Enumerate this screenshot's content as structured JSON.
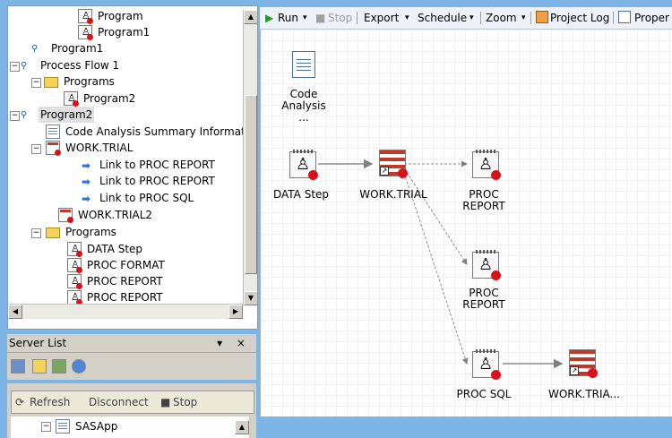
{
  "tree": {
    "items": [
      {
        "label": "Program",
        "icon": "program-icon"
      },
      {
        "label": "Program1",
        "icon": "program-icon"
      },
      {
        "label": "Program1",
        "icon": "process-flow-icon"
      },
      {
        "label": "Process Flow 1",
        "icon": "process-flow-icon"
      },
      {
        "label": "Programs",
        "icon": "folder-icon"
      },
      {
        "label": "Program2",
        "icon": "program-icon"
      },
      {
        "label": "Program2",
        "icon": "process-flow-icon"
      },
      {
        "label": "Code Analysis Summary Information",
        "icon": "document-icon"
      },
      {
        "label": "WORK.TRIAL",
        "icon": "table-icon"
      },
      {
        "label": "Link to PROC REPORT",
        "icon": "link-icon"
      },
      {
        "label": "Link to PROC REPORT",
        "icon": "link-icon"
      },
      {
        "label": "Link to PROC SQL",
        "icon": "link-icon"
      },
      {
        "label": "WORK.TRIAL2",
        "icon": "table-icon"
      },
      {
        "label": "Programs",
        "icon": "folder-icon"
      },
      {
        "label": "DATA Step",
        "icon": "program-icon"
      },
      {
        "label": "PROC FORMAT",
        "icon": "program-icon"
      },
      {
        "label": "PROC REPORT",
        "icon": "program-icon"
      },
      {
        "label": "PROC REPORT",
        "icon": "program-icon"
      }
    ]
  },
  "server_list": {
    "title": "Server List",
    "controls": "▾ ×",
    "refresh_label": "Refresh",
    "disconnect_label": "Disconnect",
    "stop_label": "Stop",
    "server_name": "SASApp"
  },
  "toolbar": {
    "run_label": "Run",
    "stop_label": "Stop",
    "export_label": "Export",
    "schedule_label": "Schedule",
    "zoom_label": "Zoom",
    "project_log_label": "Project Log",
    "properties_label": "Proper"
  },
  "canvas": {
    "code_analysis": "Code Analysis ...",
    "data_step": "DATA Step",
    "work_trial": "WORK.TRIAL",
    "proc_report_1": "PROC REPORT",
    "proc_report_2": "PROC REPORT",
    "proc_sql": "PROC SQL",
    "work_trial2": "WORK.TRIA..."
  }
}
